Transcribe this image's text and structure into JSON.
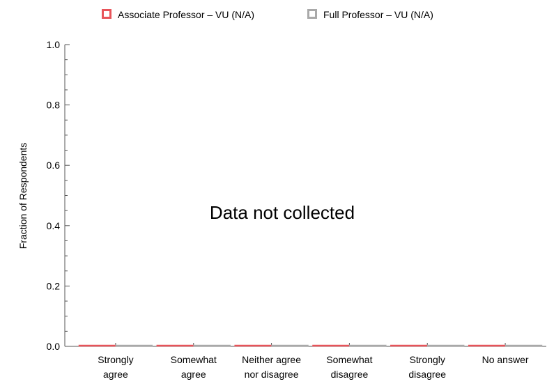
{
  "chart_data": {
    "type": "bar",
    "title": "",
    "xlabel": "",
    "ylabel": "Fraction of Respondents",
    "ylim": [
      0,
      1.0
    ],
    "yticks": [
      "0.0",
      "0.2",
      "0.4",
      "0.6",
      "0.8",
      "1.0"
    ],
    "grid": false,
    "legend_position": "top",
    "categories": [
      [
        "Strongly",
        "agree"
      ],
      [
        "Somewhat",
        "agree"
      ],
      [
        "Neither agree",
        "nor disagree"
      ],
      [
        "Somewhat",
        "disagree"
      ],
      [
        "Strongly",
        "disagree"
      ],
      [
        "No answer"
      ]
    ],
    "series": [
      {
        "name": "Associate Professor – VU (N/A)",
        "color": "#e8545a",
        "values": [
          0,
          0,
          0,
          0,
          0,
          0
        ]
      },
      {
        "name": "Full Professor – VU (N/A)",
        "color": "#a9a9a9",
        "values": [
          0,
          0,
          0,
          0,
          0,
          0
        ]
      }
    ],
    "annotation": "Data not collected"
  }
}
